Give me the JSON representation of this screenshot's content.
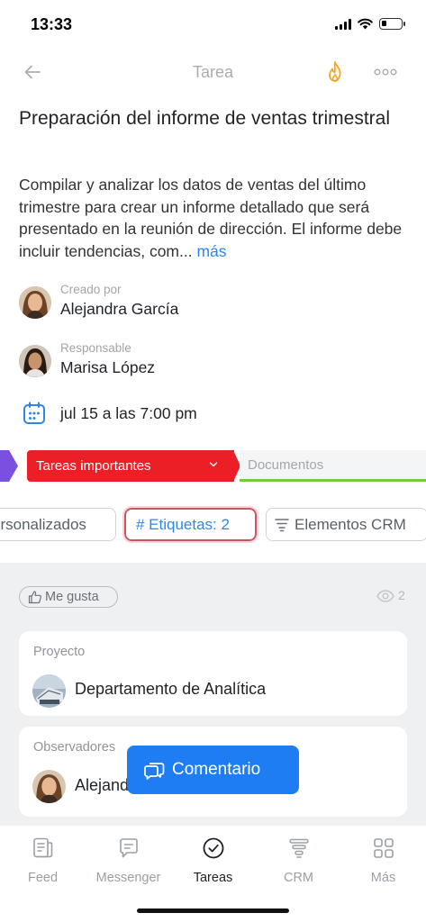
{
  "status_bar": {
    "time": "13:33"
  },
  "header": {
    "title": "Tarea",
    "icons": [
      "back-arrow-icon",
      "fire-icon",
      "more-dots-icon"
    ]
  },
  "task": {
    "title": "Preparación del informe de ventas trimestral",
    "description": "Compilar y analizar los datos de ventas del último trimestre para crear un informe detallado que será presentado en la reunión de dirección. El informe debe incluir tendencias, com...",
    "more_link": "más"
  },
  "created_by": {
    "label": "Creado por",
    "name": "Alejandra García"
  },
  "responsible": {
    "label": "Responsable",
    "name": "Marisa López"
  },
  "deadline": {
    "text": "jul 15 a las 7:00 pm"
  },
  "stages": {
    "current": "Tareas importantes",
    "next": "Documentos",
    "colors": {
      "previous": "#7b4fe0",
      "current": "#ec1f26",
      "next_underline": "#78c83a"
    }
  },
  "chips": {
    "custom": "ersonalizados",
    "tags": "# Etiquetas: 2",
    "crm": "Elementos CRM"
  },
  "reactions": {
    "like_label": "Me gusta",
    "views": "2"
  },
  "project": {
    "label": "Proyecto",
    "name": "Departamento de Analítica"
  },
  "observers": {
    "label": "Observadores",
    "first_name": "Alejandra García"
  },
  "comment_button": {
    "label": "Comentario"
  },
  "tabs": [
    {
      "label": "Feed",
      "icon": "feed-icon"
    },
    {
      "label": "Messenger",
      "icon": "messenger-icon"
    },
    {
      "label": "Tareas",
      "icon": "tasks-check-icon",
      "active": true
    },
    {
      "label": "CRM",
      "icon": "crm-filter-icon"
    },
    {
      "label": "Más",
      "icon": "grid-more-icon"
    }
  ],
  "colors": {
    "accent": "#1e7df3",
    "link": "#2f86e8",
    "background_lower": "#eef0f2"
  }
}
